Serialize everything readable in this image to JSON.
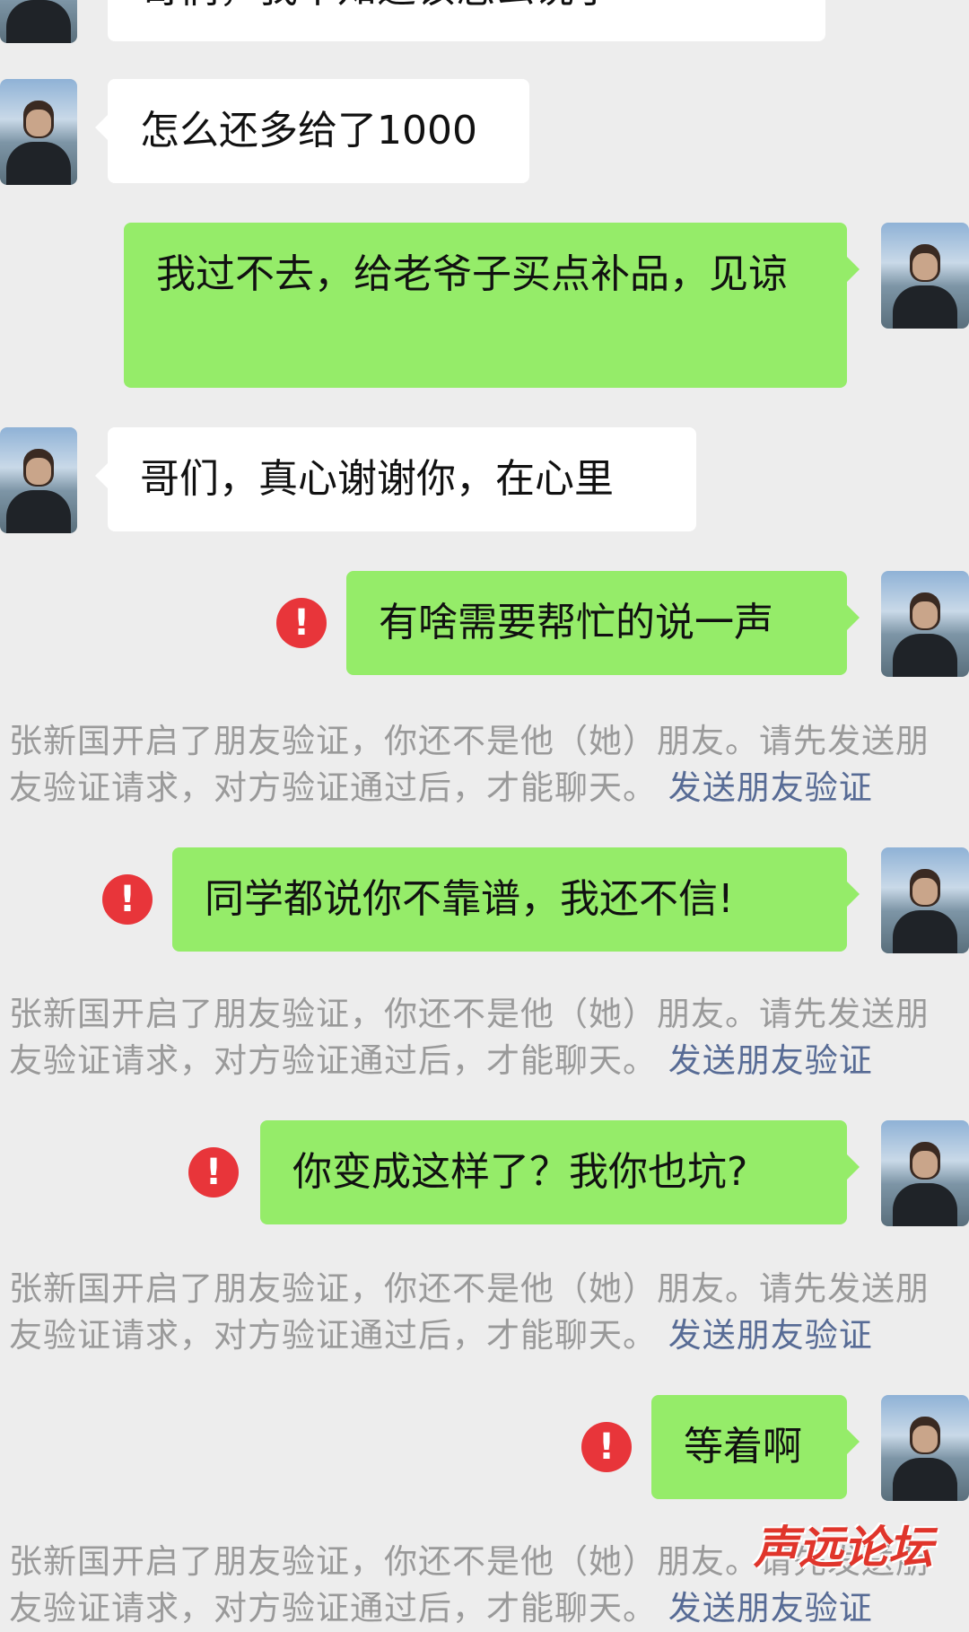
{
  "messages": [
    {
      "side": "in",
      "text": "哥们，我不知道该怎么说了"
    },
    {
      "side": "in",
      "text": "怎么还多给了1000"
    },
    {
      "side": "out",
      "text": "我过不去，给老爷子买点补品，见谅"
    },
    {
      "side": "in",
      "text": "哥们，真心谢谢你，在心里"
    },
    {
      "side": "out",
      "text": "有啥需要帮忙的说一声",
      "failed": true
    },
    {
      "side": "out",
      "text": "同学都说你不靠谱，我还不信!",
      "failed": true
    },
    {
      "side": "out",
      "text": "你变成这样了？我你也坑?",
      "failed": true
    },
    {
      "side": "out",
      "text": "等着啊",
      "failed": true
    }
  ],
  "notice": {
    "text": "张新国开启了朋友验证，你还不是他（她）朋友。请先发送朋友验证请求，对方验证通过后，才能聊天。",
    "link": "发送朋友验证"
  },
  "alert_glyph": "!",
  "icons": {
    "failed": "exclamation-circle-icon"
  },
  "colors": {
    "incoming": "#ffffff",
    "outgoing": "#95ec69",
    "failed": "#e8353a",
    "link": "#576b95",
    "background": "#ededed"
  },
  "watermark": "声远论坛"
}
